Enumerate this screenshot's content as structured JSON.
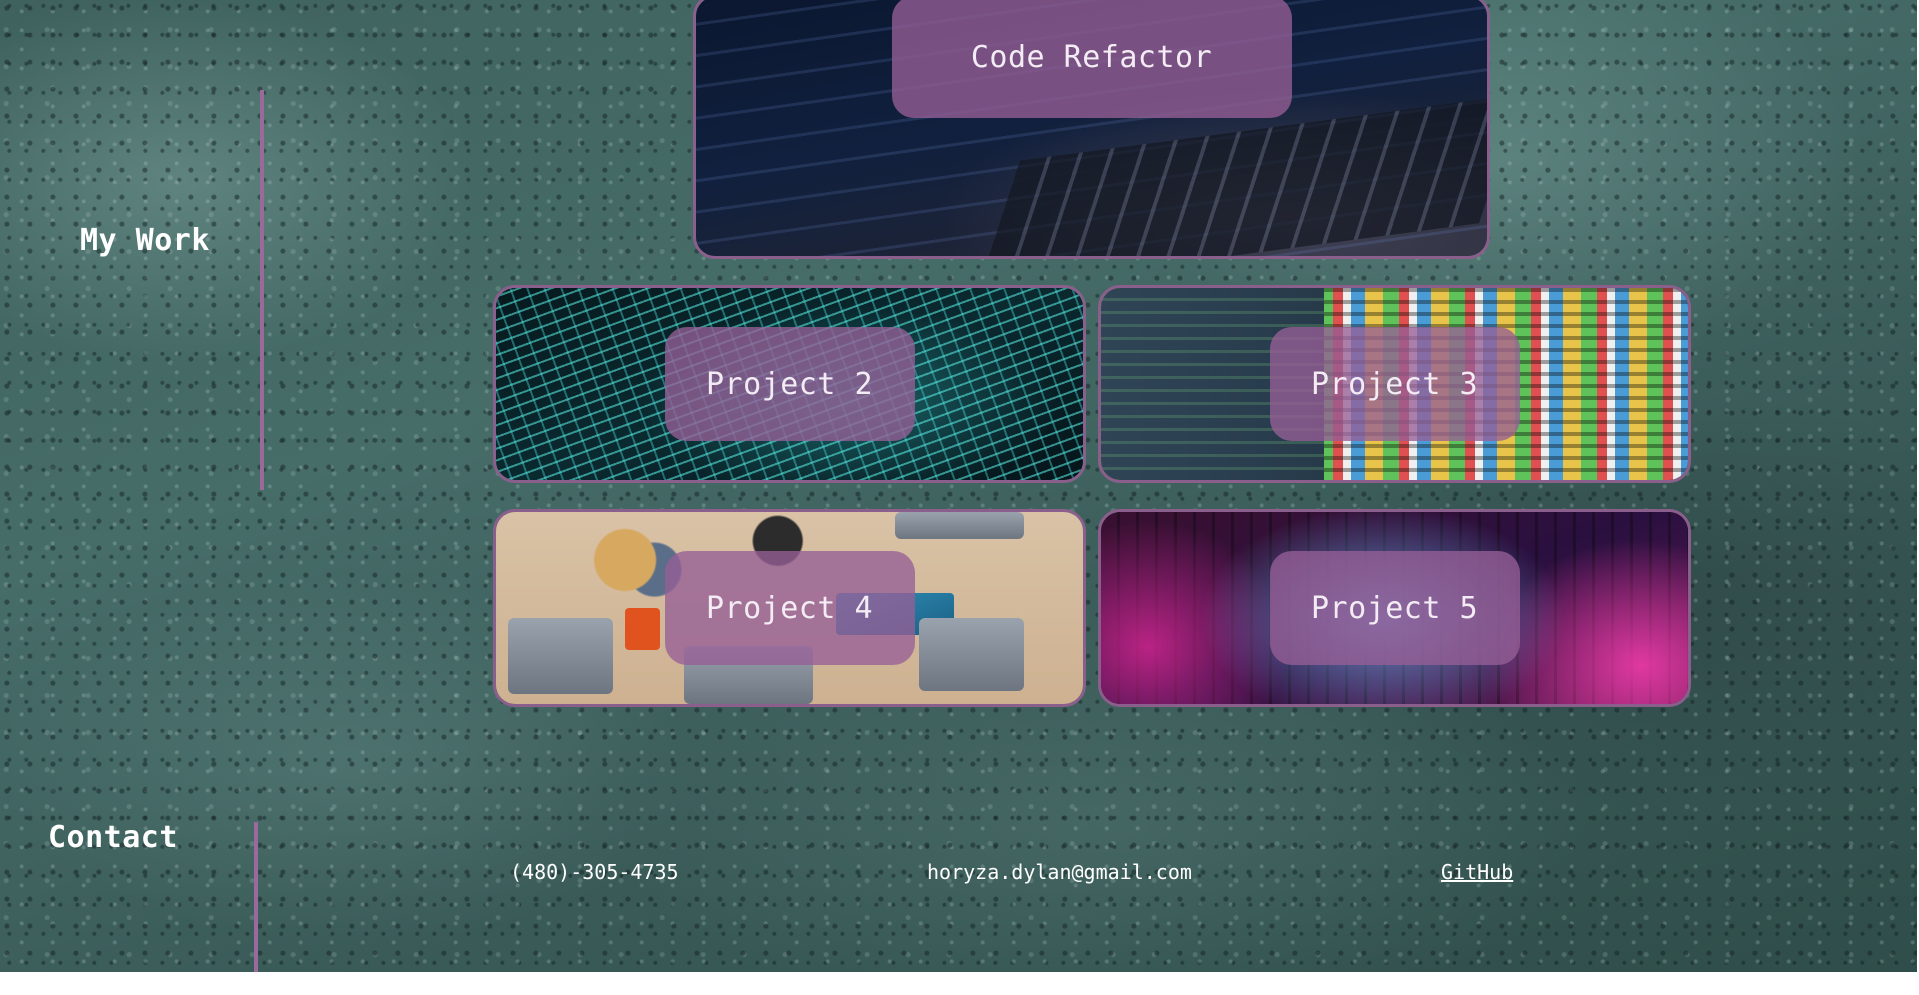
{
  "sections": {
    "work_title": "My Work",
    "contact_title": "Contact"
  },
  "projects": [
    {
      "label": "Code Refactor"
    },
    {
      "label": "Project 2"
    },
    {
      "label": "Project 3"
    },
    {
      "label": "Project 4"
    },
    {
      "label": "Project 5"
    }
  ],
  "contact": {
    "phone": "(480)-305-4735",
    "email": "horyza.dylan@gmail.com",
    "github": "GitHub"
  },
  "colors": {
    "accent": "#9a6a9a",
    "card_label_bg": "#965f96",
    "background": "#476d69"
  }
}
